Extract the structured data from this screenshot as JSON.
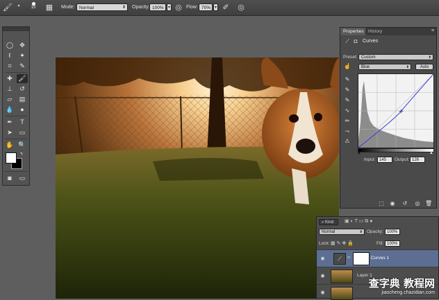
{
  "options_bar": {
    "brush_size": "15",
    "mode_label": "Mode:",
    "mode_value": "Normal",
    "opacity_label": "Opacity:",
    "opacity_value": "100%",
    "flow_label": "Flow:",
    "flow_value": "70%"
  },
  "properties": {
    "tab_properties": "Properties",
    "tab_history": "History",
    "title": "Curves",
    "preset_label": "Preset:",
    "preset_value": "Custom",
    "channel_value": "Blue",
    "auto_label": "Auto",
    "input_label": "Input:",
    "input_value": "145",
    "output_label": "Output:",
    "output_value": "126",
    "curve_point": {
      "input": 145,
      "output": 126
    }
  },
  "layers": {
    "filter_kind": "Kind",
    "blend_value": "Normal",
    "opacity_label": "Opacity:",
    "opacity_value": "100%",
    "lock_label": "Lock:",
    "fill_label": "Fill:",
    "fill_value": "100%",
    "items": [
      {
        "name": "Curves 1",
        "selected": true
      },
      {
        "name": "Layer 1",
        "selected": false
      },
      {
        "name": "",
        "selected": false
      }
    ]
  },
  "watermark": {
    "title": "查字典 教程网",
    "url": "jiaocheng.chazidian.com"
  },
  "colors": {
    "accent_selected_row": "#5c6e91",
    "curve_line": "#3a3ad8"
  }
}
